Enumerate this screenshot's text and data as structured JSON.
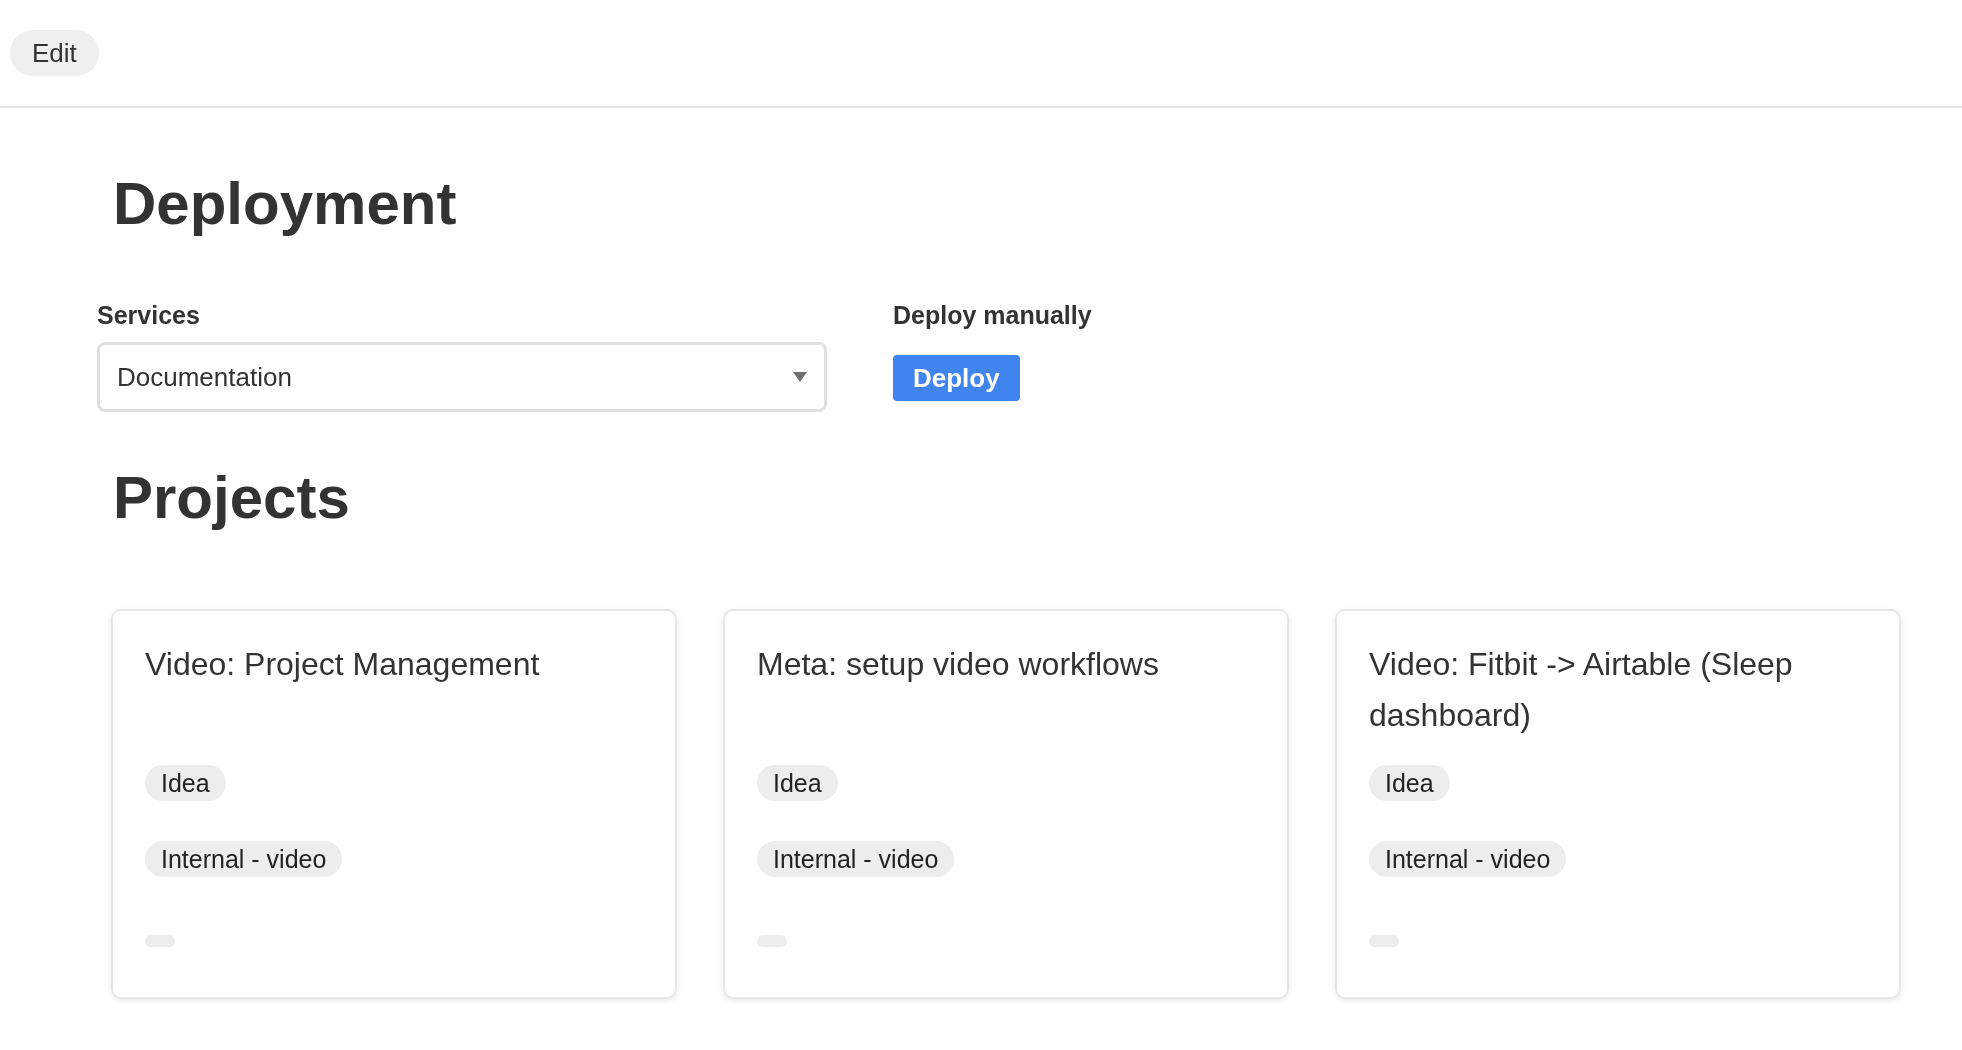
{
  "toolbar": {
    "edit_button": "Edit"
  },
  "deployment": {
    "title": "Deployment",
    "services": {
      "label": "Services",
      "value": "Documentation"
    },
    "deploy_manually": {
      "label": "Deploy manually",
      "button": "Deploy"
    }
  },
  "projects": {
    "title": "Projects",
    "cards": [
      {
        "title": "Video: Project Management",
        "tags": [
          "Idea",
          "Internal - video"
        ]
      },
      {
        "title": "Meta: setup video workflows",
        "tags": [
          "Idea",
          "Internal - video"
        ]
      },
      {
        "title": "Video: Fitbit -> Airtable (Sleep dashboard)",
        "tags": [
          "Idea",
          "Internal - video"
        ]
      }
    ]
  }
}
